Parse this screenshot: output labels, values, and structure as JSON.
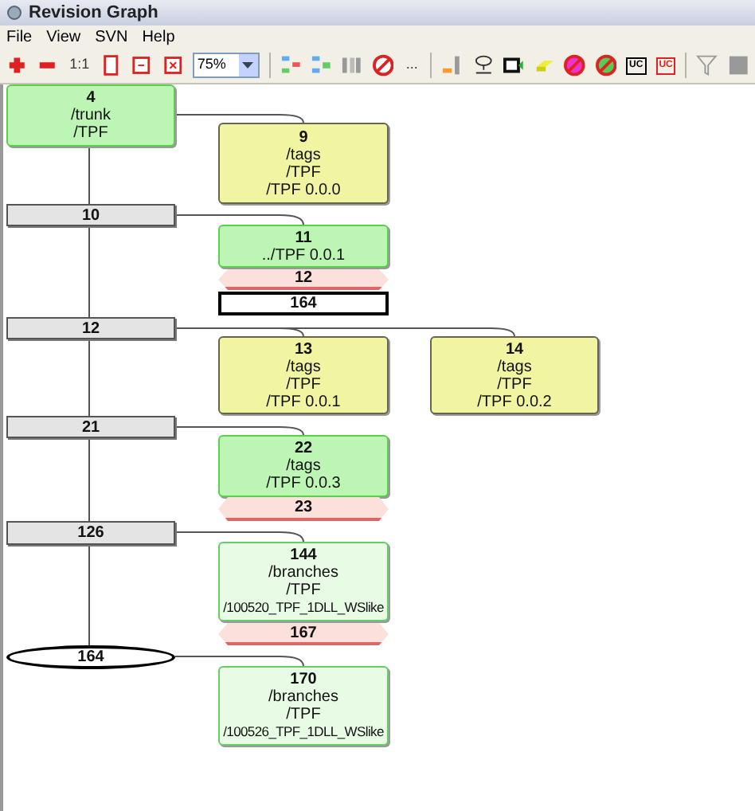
{
  "window": {
    "title": "Revision Graph"
  },
  "menu": [
    "File",
    "View",
    "SVN",
    "Help"
  ],
  "toolbar": {
    "zoom_label": "1:1",
    "zoom_value": "75%",
    "more_label": "...",
    "badge_labels": [
      "UC",
      "UC"
    ]
  },
  "nodes": [
    {
      "kind": "copy",
      "lines": [
        "4",
        "/trunk",
        "/TPF"
      ]
    },
    {
      "kind": "tag",
      "lines": [
        "9",
        "/tags",
        "/TPF",
        "/TPF 0.0.0"
      ]
    },
    {
      "kind": "revision",
      "lines": [
        "10"
      ]
    },
    {
      "kind": "copy",
      "lines": [
        "11",
        "../TPF 0.0.1"
      ]
    },
    {
      "kind": "deleted",
      "lines": [
        "12"
      ]
    },
    {
      "kind": "head",
      "lines": [
        "164"
      ]
    },
    {
      "kind": "revision",
      "lines": [
        "12"
      ]
    },
    {
      "kind": "tag",
      "lines": [
        "13",
        "/tags",
        "/TPF",
        "/TPF 0.0.1"
      ]
    },
    {
      "kind": "tag",
      "lines": [
        "14",
        "/tags",
        "/TPF",
        "/TPF 0.0.2"
      ]
    },
    {
      "kind": "revision",
      "lines": [
        "21"
      ]
    },
    {
      "kind": "copy",
      "lines": [
        "22",
        "/tags",
        "/TPF 0.0.3"
      ]
    },
    {
      "kind": "deleted",
      "lines": [
        "23"
      ]
    },
    {
      "kind": "revision",
      "lines": [
        "126"
      ]
    },
    {
      "kind": "branch",
      "lines": [
        "144",
        "/branches",
        "/TPF",
        "/100520_TPF_1DLL_WSlike"
      ]
    },
    {
      "kind": "deleted",
      "lines": [
        "167"
      ]
    },
    {
      "kind": "ellipse",
      "lines": [
        "164"
      ]
    },
    {
      "kind": "branch",
      "lines": [
        "170",
        "/branches",
        "/TPF",
        "/100526_TPF_1DLL_WSlike"
      ]
    }
  ]
}
